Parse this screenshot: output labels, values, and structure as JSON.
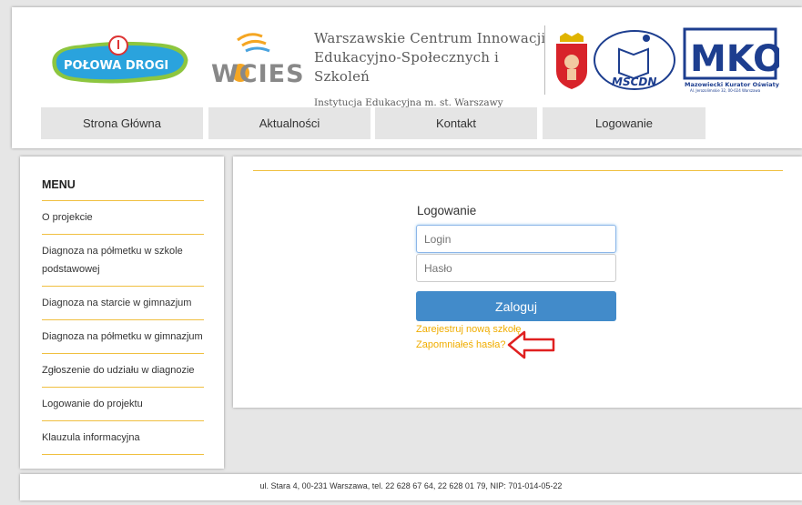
{
  "header": {
    "logo_polowa": "POŁOWA DROGI",
    "logo_wcies": "WCIES",
    "institution": {
      "line1": "Warszawskie Centrum Innowacji",
      "line2": "Edukacyjno-Społecznych i Szkoleń",
      "line3": "Instytucja Edukacyjna m. st. Warszawy"
    },
    "logo_mscdn": "MSCDN",
    "logo_mko": "MKO",
    "mko_caption": "Mazowiecki Kurator Oświaty",
    "mko_subcaption": "Al. Jerozolimskie 32, 00-024 Warszawa"
  },
  "nav": {
    "items": [
      {
        "label": "Strona Główna"
      },
      {
        "label": "Aktualności"
      },
      {
        "label": "Kontakt"
      },
      {
        "label": "Logowanie"
      }
    ]
  },
  "sidebar": {
    "title": "MENU",
    "items": [
      {
        "label": "O projekcie"
      },
      {
        "label": "Diagnoza na półmetku w szkole podstawowej"
      },
      {
        "label": "Diagnoza na starcie w gimnazjum"
      },
      {
        "label": "Diagnoza na półmetku w gimnazjum"
      },
      {
        "label": "Zgłoszenie do udziału w diagnozie"
      },
      {
        "label": "Logowanie do projektu"
      },
      {
        "label": "Klauzula informacyjna"
      }
    ]
  },
  "login": {
    "heading": "Logowanie",
    "login_placeholder": "Login",
    "password_placeholder": "Hasło",
    "button_label": "Zaloguj",
    "register_link": "Zarejestruj nową szkołę",
    "forgot_link": "Zapomniałeś hasła?"
  },
  "footer": {
    "text": "ul. Stara 4, 00-231 Warszawa, tel. 22 628 67 64, 22 628 01 79, NIP: 701-014-05-22"
  },
  "colors": {
    "accent_line": "#f0c040",
    "button": "#428bca",
    "link": "#f0ad00",
    "arrow": "#e02020"
  }
}
